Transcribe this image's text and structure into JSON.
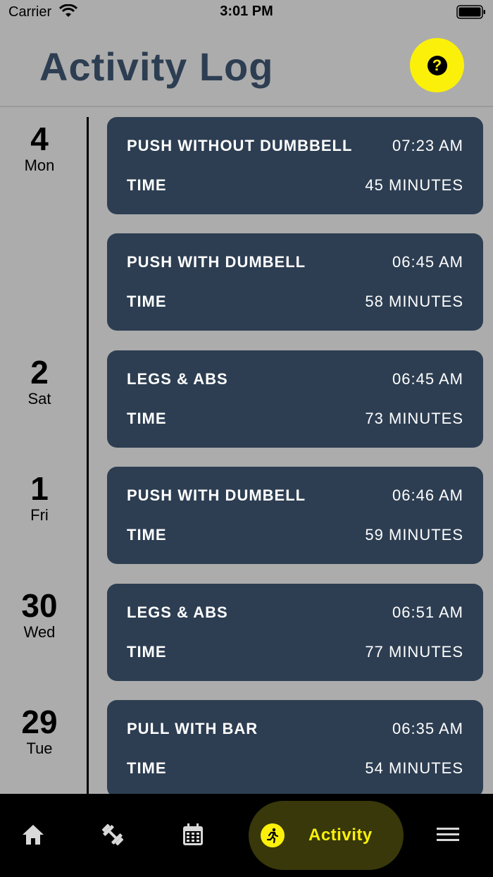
{
  "status_bar": {
    "carrier": "Carrier",
    "time": "3:01 PM"
  },
  "header": {
    "title": "Activity Log",
    "help_symbol": "?"
  },
  "timeline": {
    "dates": [
      {
        "day": "4",
        "weekday": "Mon"
      },
      {
        "day": "2",
        "weekday": "Sat"
      },
      {
        "day": "1",
        "weekday": "Fri"
      },
      {
        "day": "30",
        "weekday": "Wed"
      },
      {
        "day": "29",
        "weekday": "Tue"
      }
    ],
    "entries": [
      {
        "name": "PUSH WITHOUT DUMBBELL",
        "clock": "07:23 AM",
        "time_label": "TIME",
        "duration": "45 MINUTES"
      },
      {
        "name": "PUSH WITH DUMBELL",
        "clock": "06:45 AM",
        "time_label": "TIME",
        "duration": "58 MINUTES"
      },
      {
        "name": "LEGS & ABS",
        "clock": "06:45 AM",
        "time_label": "TIME",
        "duration": "73 MINUTES"
      },
      {
        "name": "PUSH WITH DUMBELL",
        "clock": "06:46 AM",
        "time_label": "TIME",
        "duration": "59 MINUTES"
      },
      {
        "name": "LEGS & ABS",
        "clock": "06:51 AM",
        "time_label": "TIME",
        "duration": "77 MINUTES"
      },
      {
        "name": "PULL WITH BAR",
        "clock": "06:35 AM",
        "time_label": "TIME",
        "duration": "54 MINUTES"
      }
    ]
  },
  "tab_bar": {
    "tabs": [
      {
        "icon": "home-icon"
      },
      {
        "icon": "dumbbell-icon"
      },
      {
        "icon": "calendar-icon"
      },
      {
        "icon": "running-icon",
        "label": "Activity",
        "active": true
      },
      {
        "icon": "menu-icon"
      }
    ]
  },
  "colors": {
    "accent": "#fbf00a",
    "card": "#2d3e52",
    "background": "#acacac",
    "tab_bar": "#000000"
  }
}
